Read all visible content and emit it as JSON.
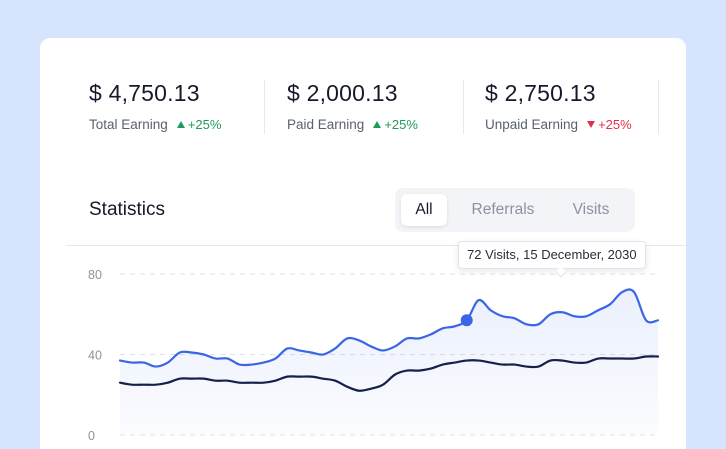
{
  "stats": [
    {
      "amount": "$ 4,750.13",
      "label": "Total Earning",
      "change": "+25%",
      "direction": "up"
    },
    {
      "amount": "$ 2,000.13",
      "label": "Paid Earning",
      "change": "+25%",
      "direction": "up"
    },
    {
      "amount": "$ 2,750.13",
      "label": "Unpaid Earning",
      "change": "+25%",
      "direction": "down"
    }
  ],
  "statistics": {
    "title": "Statistics",
    "tabs": [
      "All",
      "Referrals",
      "Visits"
    ],
    "active_tab": "All",
    "tooltip": "72 Visits, 15 December, 2030"
  },
  "colors": {
    "background": "#d6e4fd",
    "primary_line": "#3a66e6",
    "secondary_line": "#16204a",
    "up": "#1f9b58",
    "down": "#e0314a"
  },
  "chart_data": {
    "type": "line",
    "yticks": [
      80,
      40,
      0
    ],
    "ylim": [
      0,
      80
    ],
    "grid": true,
    "series": [
      {
        "values": [
          37,
          36,
          36,
          34,
          36,
          41,
          41,
          40,
          38,
          38,
          35,
          35,
          36,
          38,
          43,
          42,
          41,
          40,
          43,
          48,
          47,
          44,
          42,
          44,
          48,
          48,
          50,
          53,
          54,
          57,
          67,
          62,
          59,
          58,
          55,
          55,
          60,
          61,
          59,
          59,
          62,
          65,
          71,
          71,
          57,
          57
        ]
      },
      {
        "values": [
          26,
          25,
          25,
          25,
          26,
          28,
          28,
          28,
          27,
          27,
          26,
          26,
          26,
          27,
          29,
          29,
          29,
          28,
          27,
          24,
          22,
          23,
          25,
          30,
          32,
          32,
          33,
          35,
          36,
          37,
          37,
          36,
          35,
          35,
          34,
          34,
          37,
          37,
          36,
          36,
          38,
          38,
          38,
          38,
          39,
          39
        ]
      }
    ],
    "highlight": {
      "series": 0,
      "index": 29
    }
  }
}
